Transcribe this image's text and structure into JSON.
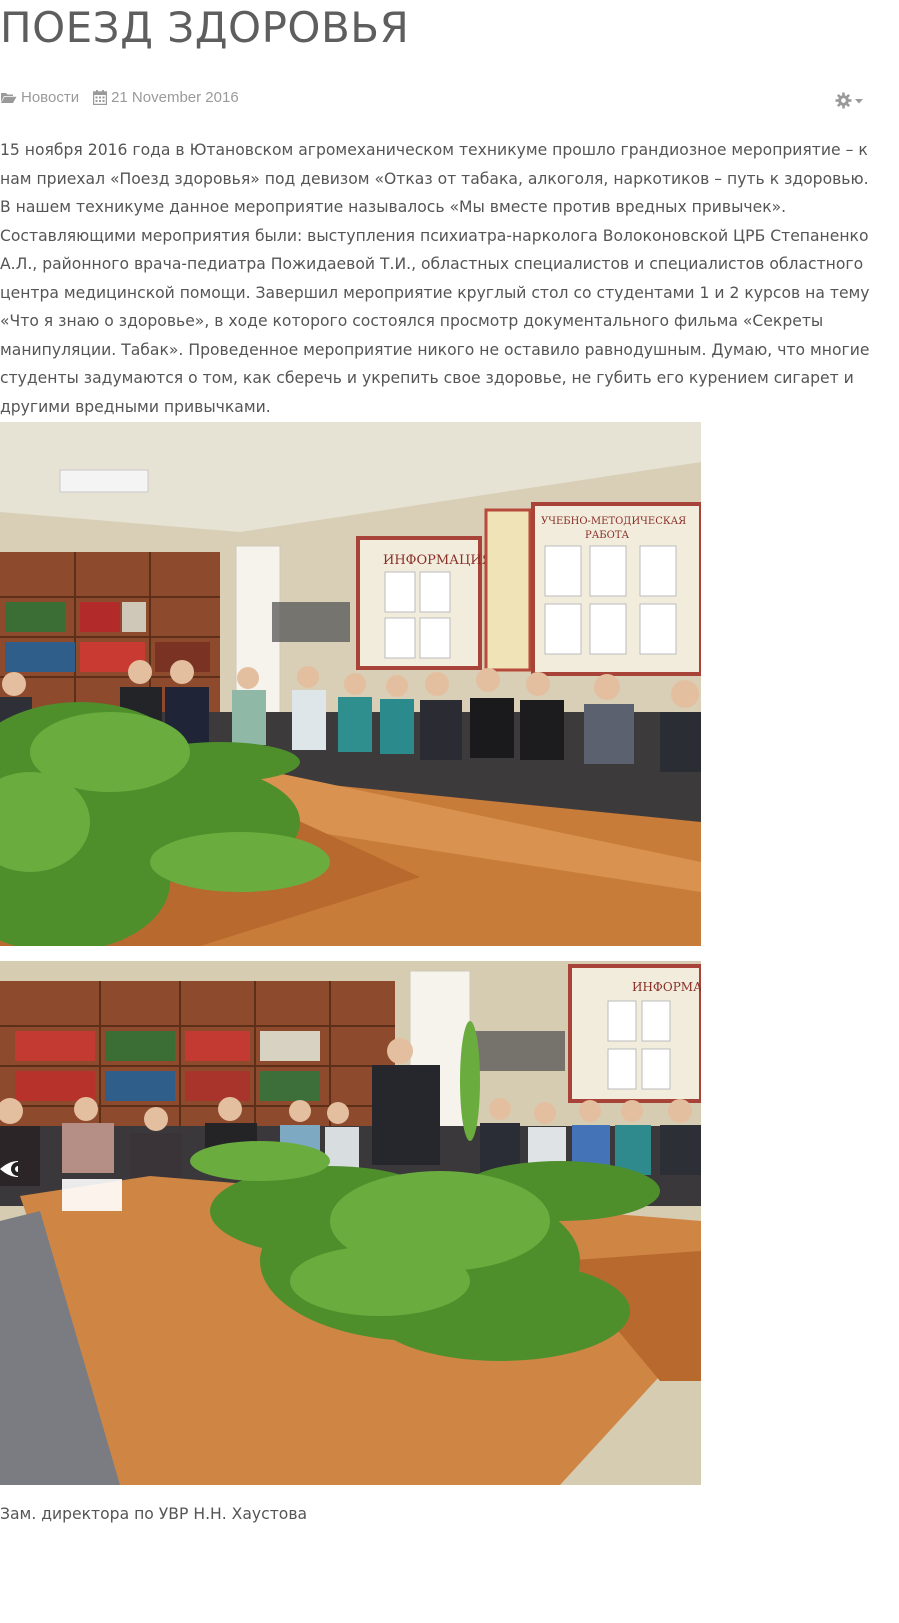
{
  "article": {
    "title": "ПОЕЗД ЗДОРОВЬЯ",
    "category": "Новости",
    "date": "21 November 2016",
    "body": "15 ноября 2016 года в Ютановском агромеханическом техникуме прошло грандиозное мероприятие – к нам приехал «Поезд здоровья» под девизом «Отказ от табака, алкоголя, наркотиков – путь к здоровью. В нашем техникуме данное мероприятие называлось «Мы вместе против вредных привычек». Составляющими мероприятия были: выступления психиатра-нарколога Волоконовской ЦРБ Степаненко А.Л., районного врача-педиатра Пожидаевой Т.И., областных специалистов и специалистов областного центра медицинской помощи. Завершил мероприятие круглый стол со студентами 1 и 2 курсов на тему «Что я знаю о здоровье», в ходе которого состоялся просмотр документального фильма «Секреты манипуляции. Табак». Проведенное мероприятие никого не оставило равнодушным. Думаю, что многие студенты задумаются о том, как сберечь и укрепить свое здоровье, не губить его курением сигарет и другими вредными привычками.",
    "caption": "Зам. директора по УВР Н.Н. Хаустова"
  },
  "photo1": {
    "board_info": "ИНФОРМАЦИЯ",
    "board_method": "УЧЕБНО-МЕТОДИЧЕСКАЯ",
    "board_method2": "РАБОТА"
  },
  "photo2": {
    "board_info": "ИНФОРМАЦ"
  },
  "icons": {
    "category": "folder-open-icon",
    "date": "calendar-icon",
    "tools": "gear-icon",
    "dropdown": "caret-down-icon",
    "view": "eye-icon"
  },
  "colors": {
    "text": "#555555",
    "meta": "#9a9a9a",
    "title": "#5e5e5e"
  }
}
